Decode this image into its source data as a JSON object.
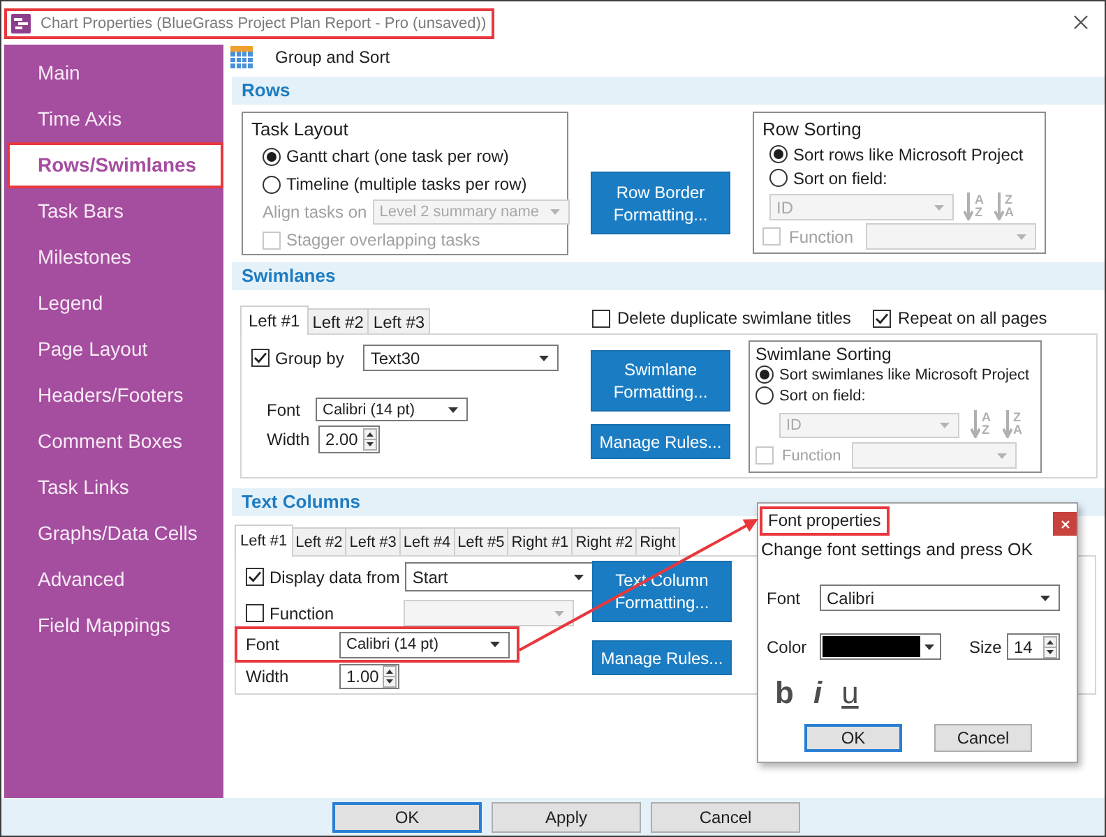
{
  "window": {
    "title": "Chart Properties (BlueGrass Project Plan Report - Pro (unsaved))",
    "title_highlighted": true
  },
  "sidebar": {
    "items": [
      {
        "label": "Main",
        "selected": false,
        "highlighted": false
      },
      {
        "label": "Time Axis",
        "selected": false,
        "highlighted": false
      },
      {
        "label": "Rows/Swimlanes",
        "selected": true,
        "highlighted": true
      },
      {
        "label": "Task Bars",
        "selected": false,
        "highlighted": false
      },
      {
        "label": "Milestones",
        "selected": false,
        "highlighted": false
      },
      {
        "label": "Legend",
        "selected": false,
        "highlighted": false
      },
      {
        "label": "Page Layout",
        "selected": false,
        "highlighted": false
      },
      {
        "label": "Headers/Footers",
        "selected": false,
        "highlighted": false
      },
      {
        "label": "Comment Boxes",
        "selected": false,
        "highlighted": false
      },
      {
        "label": "Task Links",
        "selected": false,
        "highlighted": false
      },
      {
        "label": "Graphs/Data Cells",
        "selected": false,
        "highlighted": false
      },
      {
        "label": "Advanced",
        "selected": false,
        "highlighted": false
      },
      {
        "label": "Field Mappings",
        "selected": false,
        "highlighted": false
      }
    ]
  },
  "page_header": {
    "title": "Group and Sort"
  },
  "rows": {
    "heading": "Rows",
    "task_layout": {
      "title": "Task Layout",
      "options": [
        {
          "label": "Gantt chart (one task per row)",
          "selected": true
        },
        {
          "label": "Timeline (multiple tasks per row)",
          "selected": false
        }
      ],
      "align_tasks": {
        "label": "Align tasks on",
        "value": "Level 2 summary name",
        "disabled": true
      },
      "stagger": {
        "label": "Stagger overlapping tasks",
        "checked": false,
        "disabled": true
      }
    },
    "border_button": "Row Border Formatting...",
    "sorting": {
      "title": "Row Sorting",
      "options": [
        {
          "label": "Sort rows like Microsoft Project",
          "selected": true
        },
        {
          "label": "Sort on field:",
          "selected": false
        }
      ],
      "field": {
        "value": "ID",
        "disabled": true
      },
      "order_buttons": [
        {
          "top": "A",
          "bottom": "Z"
        },
        {
          "top": "Z",
          "bottom": "A"
        }
      ],
      "function": {
        "label": "Function",
        "checked": false,
        "disabled": true
      }
    }
  },
  "swimlanes": {
    "heading": "Swimlanes",
    "tabs": [
      {
        "label": "Left #1",
        "selected": true
      },
      {
        "label": "Left #2",
        "selected": false
      },
      {
        "label": "Left #3",
        "selected": false
      }
    ],
    "options": [
      {
        "label": "Delete duplicate swimlane titles",
        "checked": false
      },
      {
        "label": "Repeat on all pages",
        "checked": true
      }
    ],
    "group_by": {
      "label": "Group by",
      "checked": true,
      "value": "Text30"
    },
    "font": {
      "label": "Font",
      "value": "Calibri (14 pt)"
    },
    "width": {
      "label": "Width",
      "value": "2.00"
    },
    "buttons": [
      "Swimlane Formatting...",
      "Manage Rules..."
    ],
    "sorting": {
      "title": "Swimlane Sorting",
      "options": [
        {
          "label": "Sort swimlanes like Microsoft Project",
          "selected": true
        },
        {
          "label": "Sort on field:",
          "selected": false
        }
      ],
      "field": {
        "value": "ID",
        "disabled": true
      },
      "order_buttons": [
        {
          "top": "A",
          "bottom": "Z"
        },
        {
          "top": "Z",
          "bottom": "A"
        }
      ],
      "function": {
        "label": "Function",
        "checked": false,
        "disabled": true
      }
    }
  },
  "text_columns": {
    "heading": "Text Columns",
    "tabs": [
      {
        "label": "Left #1",
        "selected": true
      },
      {
        "label": "Left #2",
        "selected": false
      },
      {
        "label": "Left #3",
        "selected": false
      },
      {
        "label": "Left #4",
        "selected": false
      },
      {
        "label": "Left #5",
        "selected": false
      },
      {
        "label": "Right #1",
        "selected": false
      },
      {
        "label": "Right #2",
        "selected": false
      },
      {
        "label": "Right",
        "selected": false
      }
    ],
    "display": {
      "label": "Display data from",
      "checked": true,
      "value": "Start"
    },
    "function": {
      "label": "Function",
      "checked": false
    },
    "font": {
      "label": "Font",
      "value": "Calibri (14 pt)",
      "highlighted": true
    },
    "width": {
      "label": "Width",
      "value": "1.00"
    },
    "buttons": [
      "Text Column Formatting...",
      "Manage Rules..."
    ]
  },
  "font_dialog": {
    "title": "Font properties",
    "title_highlighted": true,
    "instruction": "Change font settings and press OK",
    "font": {
      "label": "Font",
      "value": "Calibri"
    },
    "color": {
      "label": "Color",
      "color": "#000000"
    },
    "size": {
      "label": "Size",
      "value": "14"
    },
    "styles": [
      {
        "kind": "bold",
        "label": "b"
      },
      {
        "kind": "italic",
        "label": "i"
      },
      {
        "kind": "underline",
        "label": "u"
      }
    ],
    "buttons": [
      {
        "label": "OK",
        "default": true
      },
      {
        "label": "Cancel",
        "default": false
      }
    ]
  },
  "callout_arrow": true,
  "footer": {
    "buttons": [
      {
        "label": "OK",
        "default": true
      },
      {
        "label": "Apply",
        "default": false
      },
      {
        "label": "Cancel",
        "default": false
      }
    ]
  }
}
